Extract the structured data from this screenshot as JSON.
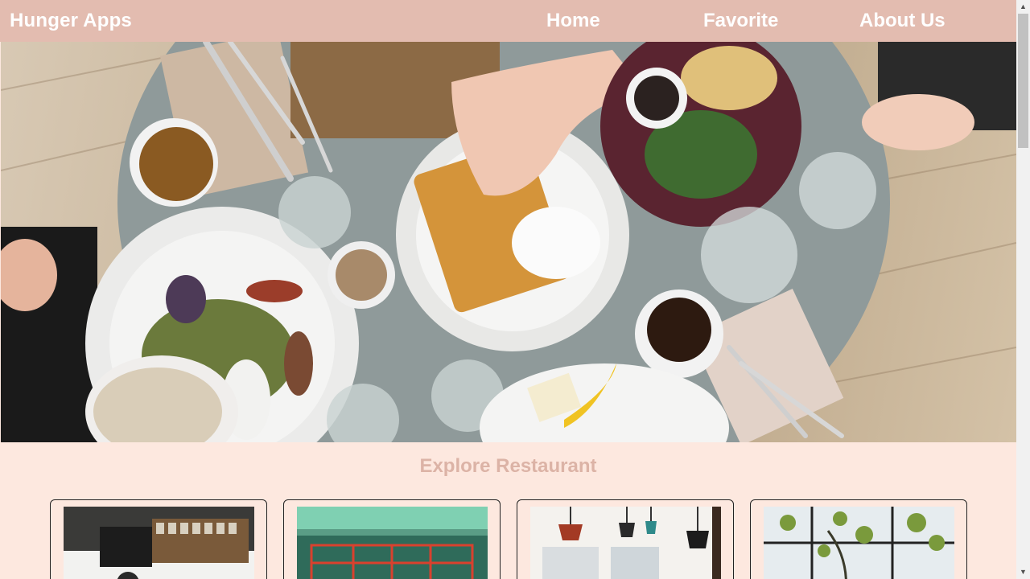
{
  "header": {
    "brand": "Hunger Apps",
    "nav": [
      {
        "label": "Home"
      },
      {
        "label": "Favorite"
      },
      {
        "label": "About Us"
      }
    ]
  },
  "hero": {
    "icon": "hero-food-table-image"
  },
  "explore": {
    "title": "Explore Restaurant",
    "cards": [
      {
        "image": "restaurant-kitchen-image"
      },
      {
        "image": "restaurant-storefront-image"
      },
      {
        "image": "restaurant-interior-lamps-image"
      },
      {
        "image": "restaurant-plants-window-image"
      }
    ]
  },
  "colors": {
    "header_bg": "#e3bcb0",
    "page_bg": "#fde8df",
    "title_color": "#dcb3a6",
    "nav_text": "#ffffff"
  }
}
